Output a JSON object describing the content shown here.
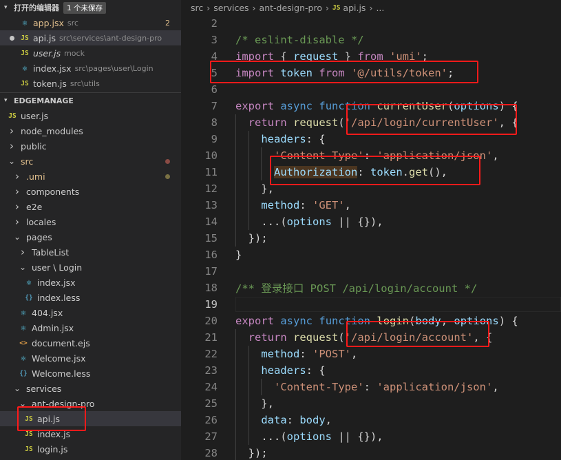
{
  "open_editors": {
    "title": "打开的编辑器",
    "badge": "1 个未保存",
    "items": [
      {
        "icon": "jsx",
        "name": "app.jsx",
        "desc": "src",
        "status": "2",
        "modified": true,
        "italic": false,
        "dirty": false
      },
      {
        "icon": "js",
        "name": "api.js",
        "desc": "src\\services\\ant-design-pro",
        "status": "",
        "modified": false,
        "italic": false,
        "dirty": true,
        "active": true
      },
      {
        "icon": "js",
        "name": "user.js",
        "desc": "mock",
        "status": "",
        "modified": false,
        "italic": true,
        "dirty": false
      },
      {
        "icon": "jsx",
        "name": "index.jsx",
        "desc": "src\\pages\\user\\Login",
        "status": "",
        "modified": false,
        "italic": false,
        "dirty": false
      },
      {
        "icon": "js",
        "name": "token.js",
        "desc": "src\\utils",
        "status": "",
        "modified": false,
        "italic": false,
        "dirty": false
      }
    ]
  },
  "explorer": {
    "title": "EDGEMANAGE",
    "items": [
      {
        "depth": 0,
        "type": "file",
        "icon": "js",
        "name": "user.js"
      },
      {
        "depth": 0,
        "type": "folder",
        "open": false,
        "name": "node_modules"
      },
      {
        "depth": 0,
        "type": "folder",
        "open": false,
        "name": "public"
      },
      {
        "depth": 0,
        "type": "folder",
        "open": true,
        "name": "src",
        "modified": true,
        "dot": "red"
      },
      {
        "depth": 1,
        "type": "folder",
        "open": false,
        "name": ".umi",
        "modified": true,
        "dot": "yellow"
      },
      {
        "depth": 1,
        "type": "folder",
        "open": false,
        "name": "components"
      },
      {
        "depth": 1,
        "type": "folder",
        "open": false,
        "name": "e2e"
      },
      {
        "depth": 1,
        "type": "folder",
        "open": false,
        "name": "locales"
      },
      {
        "depth": 1,
        "type": "folder",
        "open": true,
        "name": "pages"
      },
      {
        "depth": 2,
        "type": "folder",
        "open": false,
        "name": "TableList"
      },
      {
        "depth": 2,
        "type": "folder",
        "open": true,
        "name": "user \\ Login"
      },
      {
        "depth": 3,
        "type": "file",
        "icon": "react",
        "name": "index.jsx"
      },
      {
        "depth": 3,
        "type": "file",
        "icon": "less",
        "name": "index.less"
      },
      {
        "depth": 2,
        "type": "file",
        "icon": "jsx",
        "name": "404.jsx"
      },
      {
        "depth": 2,
        "type": "file",
        "icon": "react",
        "name": "Admin.jsx"
      },
      {
        "depth": 2,
        "type": "file",
        "icon": "ejs",
        "name": "document.ejs"
      },
      {
        "depth": 2,
        "type": "file",
        "icon": "react",
        "name": "Welcome.jsx"
      },
      {
        "depth": 2,
        "type": "file",
        "icon": "less",
        "name": "Welcome.less"
      },
      {
        "depth": 1,
        "type": "folder",
        "open": true,
        "name": "services"
      },
      {
        "depth": 2,
        "type": "folder",
        "open": true,
        "name": "ant-design-pro"
      },
      {
        "depth": 3,
        "type": "file",
        "icon": "js",
        "name": "api.js",
        "active": true
      },
      {
        "depth": 3,
        "type": "file",
        "icon": "js",
        "name": "index.js"
      },
      {
        "depth": 3,
        "type": "file",
        "icon": "js",
        "name": "login.js"
      }
    ]
  },
  "breadcrumb": [
    "src",
    "services",
    "ant-design-pro",
    "api.js",
    "..."
  ],
  "editor": {
    "current_line": 19,
    "lines": [
      {
        "n": 2,
        "t": []
      },
      {
        "n": 3,
        "t": [
          [
            "cmt",
            "/* eslint-disable */"
          ]
        ]
      },
      {
        "n": 4,
        "t": [
          [
            "kw2",
            "import"
          ],
          [
            "pn",
            " { "
          ],
          [
            "vr",
            "request"
          ],
          [
            "pn",
            " } "
          ],
          [
            "kw2",
            "from"
          ],
          [
            "pn",
            " "
          ],
          [
            "str",
            "'umi'"
          ],
          [
            "pn",
            ";"
          ]
        ]
      },
      {
        "n": 5,
        "t": [
          [
            "kw2",
            "import"
          ],
          [
            "pn",
            " "
          ],
          [
            "vr",
            "token"
          ],
          [
            "pn",
            " "
          ],
          [
            "kw2",
            "from"
          ],
          [
            "pn",
            " "
          ],
          [
            "str",
            "'@/utils/token'"
          ],
          [
            "pn",
            ";"
          ]
        ]
      },
      {
        "n": 6,
        "t": []
      },
      {
        "n": 7,
        "t": [
          [
            "kw2",
            "export"
          ],
          [
            "pn",
            " "
          ],
          [
            "kw",
            "async"
          ],
          [
            "pn",
            " "
          ],
          [
            "kw",
            "function"
          ],
          [
            "pn",
            " "
          ],
          [
            "fn",
            "currentUser"
          ],
          [
            "pn",
            "("
          ],
          [
            "vr",
            "options"
          ],
          [
            "pn",
            ") {"
          ]
        ]
      },
      {
        "n": 8,
        "t": [
          [
            "pn",
            "  "
          ],
          [
            "kw2",
            "return"
          ],
          [
            "pn",
            " "
          ],
          [
            "fn",
            "request"
          ],
          [
            "pn",
            "("
          ],
          [
            "str",
            "'/api/login/currentUser'"
          ],
          [
            "pn",
            ", {"
          ]
        ]
      },
      {
        "n": 9,
        "t": [
          [
            "pn",
            "    "
          ],
          [
            "vr",
            "headers"
          ],
          [
            "pn",
            ": {"
          ]
        ]
      },
      {
        "n": 10,
        "t": [
          [
            "pn",
            "      "
          ],
          [
            "str",
            "'Content-Type'"
          ],
          [
            "pn",
            ": "
          ],
          [
            "str",
            "'application/json'"
          ],
          [
            "pn",
            ","
          ]
        ]
      },
      {
        "n": 11,
        "t": [
          [
            "pn",
            "      "
          ],
          [
            "vr hl",
            "Authorization"
          ],
          [
            "pn",
            ": "
          ],
          [
            "vr",
            "token"
          ],
          [
            "pn",
            "."
          ],
          [
            "fn",
            "get"
          ],
          [
            "pn",
            "(),"
          ]
        ]
      },
      {
        "n": 12,
        "t": [
          [
            "pn",
            "    },"
          ]
        ]
      },
      {
        "n": 13,
        "t": [
          [
            "pn",
            "    "
          ],
          [
            "vr",
            "method"
          ],
          [
            "pn",
            ": "
          ],
          [
            "str",
            "'GET'"
          ],
          [
            "pn",
            ","
          ]
        ]
      },
      {
        "n": 14,
        "t": [
          [
            "pn",
            "    ...("
          ],
          [
            "vr",
            "options"
          ],
          [
            "pn",
            " || {}),"
          ]
        ]
      },
      {
        "n": 15,
        "t": [
          [
            "pn",
            "  });"
          ]
        ]
      },
      {
        "n": 16,
        "t": [
          [
            "pn",
            "}"
          ]
        ]
      },
      {
        "n": 17,
        "t": []
      },
      {
        "n": 18,
        "t": [
          [
            "cmt",
            "/** 登录接口 POST /api/login/account */"
          ]
        ]
      },
      {
        "n": 19,
        "t": []
      },
      {
        "n": 20,
        "t": [
          [
            "kw2",
            "export"
          ],
          [
            "pn",
            " "
          ],
          [
            "kw",
            "async"
          ],
          [
            "pn",
            " "
          ],
          [
            "kw",
            "function"
          ],
          [
            "pn",
            " "
          ],
          [
            "fn",
            "login"
          ],
          [
            "pn",
            "("
          ],
          [
            "vr",
            "body"
          ],
          [
            "pn",
            ", "
          ],
          [
            "vr",
            "options"
          ],
          [
            "pn",
            ") {"
          ]
        ]
      },
      {
        "n": 21,
        "t": [
          [
            "pn",
            "  "
          ],
          [
            "kw2",
            "return"
          ],
          [
            "pn",
            " "
          ],
          [
            "fn",
            "request"
          ],
          [
            "pn",
            "("
          ],
          [
            "str",
            "'/api/login/account'"
          ],
          [
            "pn",
            ", {"
          ]
        ]
      },
      {
        "n": 22,
        "t": [
          [
            "pn",
            "    "
          ],
          [
            "vr",
            "method"
          ],
          [
            "pn",
            ": "
          ],
          [
            "str",
            "'POST'"
          ],
          [
            "pn",
            ","
          ]
        ]
      },
      {
        "n": 23,
        "t": [
          [
            "pn",
            "    "
          ],
          [
            "vr",
            "headers"
          ],
          [
            "pn",
            ": {"
          ]
        ]
      },
      {
        "n": 24,
        "t": [
          [
            "pn",
            "      "
          ],
          [
            "str",
            "'Content-Type'"
          ],
          [
            "pn",
            ": "
          ],
          [
            "str",
            "'application/json'"
          ],
          [
            "pn",
            ","
          ]
        ]
      },
      {
        "n": 25,
        "t": [
          [
            "pn",
            "    },"
          ]
        ]
      },
      {
        "n": 26,
        "t": [
          [
            "pn",
            "    "
          ],
          [
            "vr",
            "data"
          ],
          [
            "pn",
            ": "
          ],
          [
            "vr",
            "body"
          ],
          [
            "pn",
            ","
          ]
        ]
      },
      {
        "n": 27,
        "t": [
          [
            "pn",
            "    ...("
          ],
          [
            "vr",
            "options"
          ],
          [
            "pn",
            " || {}),"
          ]
        ]
      },
      {
        "n": 28,
        "t": [
          [
            "pn",
            "  });"
          ]
        ]
      }
    ]
  },
  "colors": {
    "annotation": "#ff1a1a",
    "background": "#1e1e1e",
    "sidebar": "#252526"
  }
}
